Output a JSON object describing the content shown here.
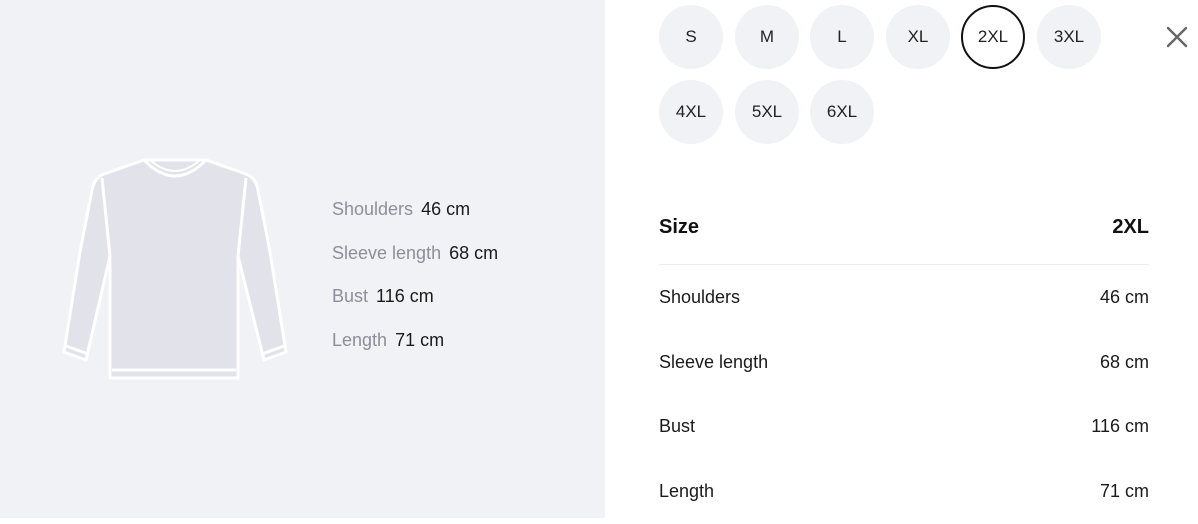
{
  "image": {
    "icon": "sweater-illustration",
    "color": "#e2e2ea"
  },
  "specs_overlay": [
    {
      "label": "Shoulders",
      "value": "46 cm"
    },
    {
      "label": "Sleeve length",
      "value": "68 cm"
    },
    {
      "label": "Bust",
      "value": "116 cm"
    },
    {
      "label": "Length",
      "value": "71 cm"
    }
  ],
  "sizes": {
    "options": [
      "S",
      "M",
      "L",
      "XL",
      "2XL",
      "3XL",
      "4XL",
      "5XL",
      "6XL"
    ],
    "selected": "2XL"
  },
  "close": {
    "icon": "close-icon"
  },
  "table": {
    "header": {
      "label": "Size",
      "value": "2XL"
    },
    "rows": [
      {
        "label": "Shoulders",
        "value": "46 cm"
      },
      {
        "label": "Sleeve length",
        "value": "68 cm"
      },
      {
        "label": "Bust",
        "value": "116 cm"
      },
      {
        "label": "Length",
        "value": "71 cm"
      }
    ]
  },
  "colors": {
    "panel_bg": "#f1f2f6",
    "muted_text": "#8d8e99",
    "selected_border": "#111111"
  }
}
